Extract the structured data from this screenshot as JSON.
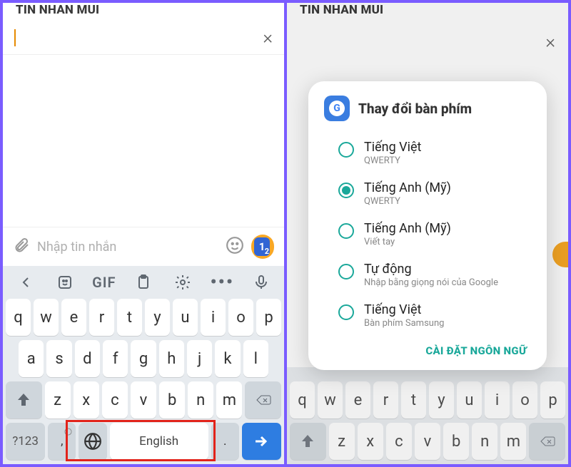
{
  "left": {
    "header_title": "TIN NHAN MUI",
    "message_placeholder": "Nhập tin nhắn",
    "sim_primary": "1",
    "sim_secondary": "2",
    "toolbar_gif": "GIF",
    "rows": {
      "r1": [
        "q",
        "w",
        "e",
        "r",
        "t",
        "y",
        "u",
        "i",
        "o",
        "p"
      ],
      "r2": [
        "a",
        "s",
        "d",
        "f",
        "g",
        "h",
        "j",
        "k",
        "l"
      ],
      "r3": [
        "z",
        "x",
        "c",
        "v",
        "b",
        "n",
        "m"
      ]
    },
    "sym_label": "?123",
    "comma": ",",
    "space_label": "English",
    "period": "."
  },
  "right": {
    "header_title": "TIN NHAN MUI",
    "dialog_title": "Thay đổi bàn phím",
    "options": [
      {
        "label": "Tiếng Việt",
        "sub": "QWERTY",
        "selected": false
      },
      {
        "label": "Tiếng Anh (Mỹ)",
        "sub": "QWERTY",
        "selected": true
      },
      {
        "label": "Tiếng Anh (Mỹ)",
        "sub": "Viết tay",
        "selected": false
      },
      {
        "label": "Tự động",
        "sub": "Nhập bằng giọng nói của Google",
        "selected": false
      },
      {
        "label": "Tiếng Việt",
        "sub": "Bàn phím Samsung",
        "selected": false
      }
    ],
    "footer_action": "CÀI ĐẶT NGÔN NGỮ",
    "rows": {
      "r1": [
        "q",
        "w",
        "e",
        "r",
        "t",
        "y",
        "u",
        "i",
        "o",
        "p"
      ],
      "r3": [
        "z",
        "x",
        "c",
        "v",
        "b",
        "n",
        "m"
      ]
    }
  }
}
